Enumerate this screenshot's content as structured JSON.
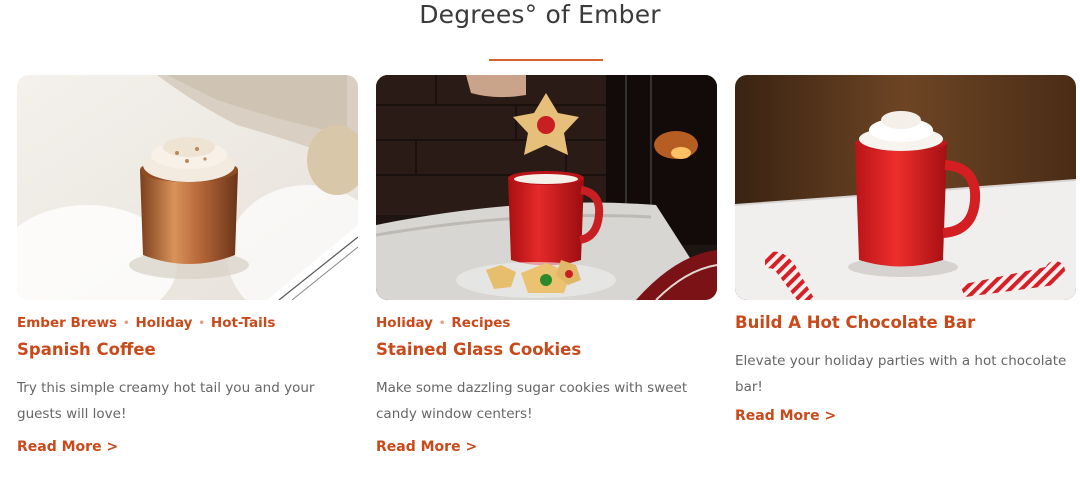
{
  "section": {
    "title": "Degrees° of Ember"
  },
  "cards": [
    {
      "image_alt": "Copper Ember mug with whipped cream on a white fluffy blanket",
      "tags": [
        "Ember Brews",
        "Holiday",
        "Hot-Tails"
      ],
      "title": "Spanish Coffee",
      "excerpt": "Try this simple creamy hot tail you and your guests will love!",
      "read_more": "Read More >"
    },
    {
      "image_alt": "Red Ember mug with stained glass sugar cookies near a fireplace",
      "tags": [
        "Holiday",
        "Recipes"
      ],
      "title": "Stained Glass Cookies",
      "excerpt": "Make some dazzling sugar cookies with sweet candy window centers!",
      "read_more": "Read More >"
    },
    {
      "image_alt": "Red Ember mug with whipped cream and candy canes on a table",
      "tags": [],
      "title": "Build A Hot Chocolate Bar",
      "excerpt": "Elevate your holiday parties with a hot chocolate bar!",
      "read_more": "Read More >"
    }
  ],
  "colors": {
    "accent": "#c9491a",
    "rule": "#d8622f",
    "text": "#666666",
    "heading": "#3b3b3b"
  }
}
